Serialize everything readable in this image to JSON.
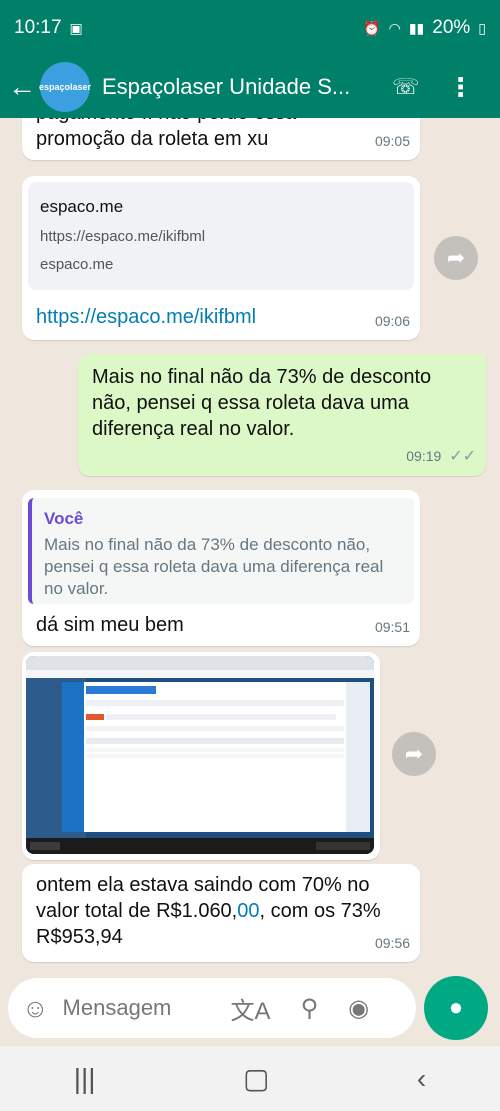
{
  "status_bar": {
    "time": "10:17",
    "battery": "20%"
  },
  "header": {
    "back_icon": "back-arrow-icon",
    "avatar_text": "espaçolaser",
    "title": "Espaçolaser Unidade S...",
    "call_icon": "add-call-icon",
    "menu_icon": "more-vert-icon"
  },
  "messages": {
    "m1": {
      "text": "pagamento .. não perde essa promoção da roleta em xu",
      "time": "09:05"
    },
    "m2": {
      "preview_title": "espaco.me",
      "preview_url": "https://espaco.me/ikifbml",
      "preview_domain": "espaco.me",
      "link": "https://espaco.me/ikifbml",
      "time": "09:06"
    },
    "m3": {
      "text": "Mais no final não da 73% de desconto não, pensei q essa roleta dava uma diferença real no valor.",
      "time": "09:19"
    },
    "m4": {
      "quote_author": "Você",
      "quote_text": "Mais no final não da 73% de desconto não, pensei q essa roleta dava uma diferença real no valor.",
      "text": "dá sim meu bem",
      "time": "09:51"
    },
    "m5": {
      "image_alt": "Screenshot of a desktop application"
    },
    "m6": {
      "text_a": "ontem ela estava saindo com 70% no valor total de R$1.060,",
      "text_link": "00",
      "text_b": ", com os 73% R$953,94",
      "time": "09:56"
    }
  },
  "input": {
    "placeholder": "Mensagem"
  }
}
